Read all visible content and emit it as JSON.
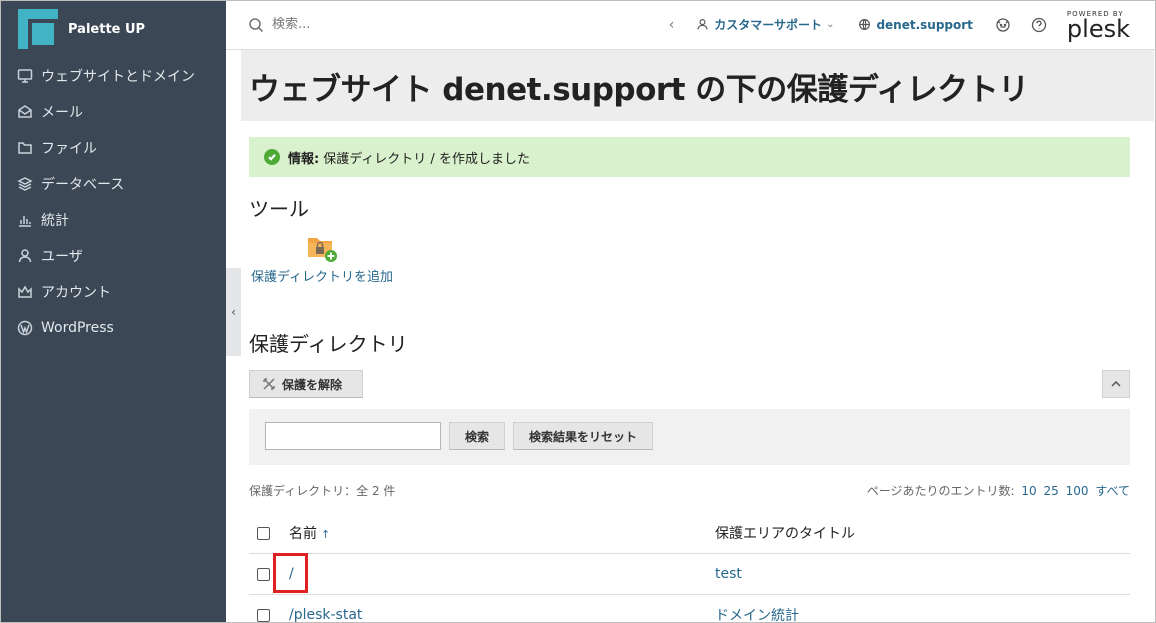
{
  "brand": {
    "name": "Palette UP"
  },
  "sidebar": {
    "items": [
      {
        "label": "ウェブサイトとドメイン",
        "icon": "monitor-icon"
      },
      {
        "label": "メール",
        "icon": "mail-icon"
      },
      {
        "label": "ファイル",
        "icon": "folder-icon"
      },
      {
        "label": "データベース",
        "icon": "database-icon"
      },
      {
        "label": "統計",
        "icon": "chart-icon"
      },
      {
        "label": "ユーザ",
        "icon": "user-icon"
      },
      {
        "label": "アカウント",
        "icon": "crown-icon"
      },
      {
        "label": "WordPress",
        "icon": "wordpress-icon"
      }
    ],
    "collapse_glyph": "‹"
  },
  "header": {
    "search_placeholder": "検索...",
    "back_glyph": "‹",
    "user": "カスタマーサポート",
    "domain": "denet.support",
    "powered_by": "POWERED BY",
    "plesk": "plesk"
  },
  "page": {
    "title": "ウェブサイト denet.support の下の保護ディレクトリ"
  },
  "message": {
    "label": "情報:",
    "text": "保護ディレクトリ / を作成しました"
  },
  "tools": {
    "heading": "ツール",
    "add_label": "保護ディレクトリを追加"
  },
  "list": {
    "heading": "保護ディレクトリ",
    "unprotect_label": "保護を解除",
    "search_button": "検索",
    "reset_button": "検索結果をリセット",
    "count_text": "保護ディレクトリ：全 2 件",
    "per_page_label": "ページあたりのエントリ数:",
    "per_page_options": [
      "10",
      "25",
      "100",
      "すべて"
    ],
    "columns": {
      "name": "名前",
      "title": "保護エリアのタイトル",
      "sort_glyph": "↑"
    },
    "rows": [
      {
        "name": "/",
        "title": "test"
      },
      {
        "name": "/plesk-stat",
        "title": "ドメイン統計"
      }
    ]
  },
  "colors": {
    "sidebar_bg": "#3b4754",
    "accent": "#41b3c4",
    "link": "#28688d",
    "success_bg": "#d9f1cc",
    "highlight": "#e02020"
  }
}
